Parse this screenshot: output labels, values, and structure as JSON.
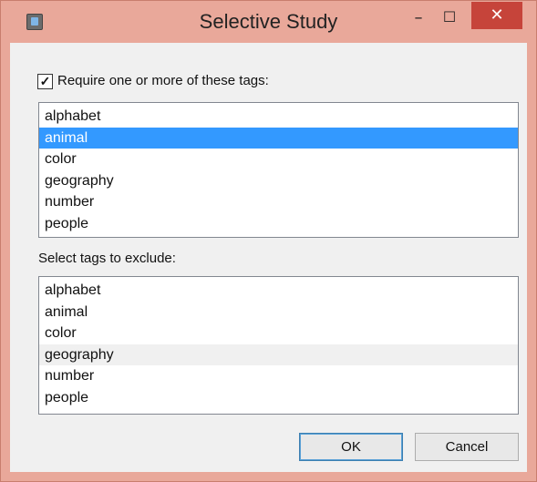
{
  "window": {
    "title": "Selective Study",
    "controls": {
      "minimize": "–",
      "maximize": "☐",
      "close": "✕"
    }
  },
  "require": {
    "checked": true,
    "checkmark": "✓",
    "label": "Require one or more of these tags:",
    "items": [
      "alphabet",
      "animal",
      "color",
      "geography",
      "number",
      "people"
    ],
    "selected": "animal"
  },
  "exclude": {
    "label": "Select tags to exclude:",
    "items": [
      "alphabet",
      "animal",
      "color",
      "geography",
      "number",
      "people"
    ],
    "hovered": "geography"
  },
  "buttons": {
    "ok": "OK",
    "cancel": "Cancel"
  },
  "colors": {
    "selection": "#3399ff",
    "close_button": "#c6443a",
    "frame": "#e9a89a"
  }
}
